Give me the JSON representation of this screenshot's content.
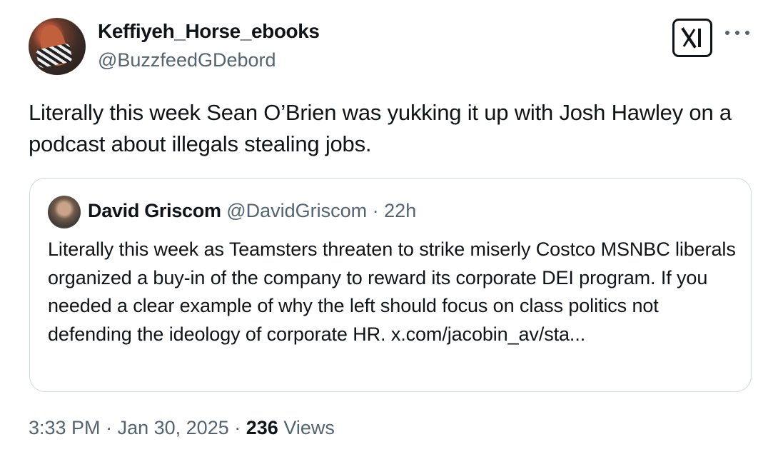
{
  "author": {
    "display_name": "Keffiyeh_Horse_ebooks",
    "handle": "@BuzzfeedGDebord"
  },
  "tweet": {
    "text": "Literally this week Sean O’Brien was yukking it up with Josh Hawley on a podcast about illegals stealing jobs."
  },
  "quoted_tweet": {
    "display_name": "David Griscom",
    "handle": "@DavidGriscom",
    "separator": "·",
    "age": "22h",
    "text": "Literally this week as Teamsters threaten to strike miserly Costco MSNBC liberals organized a buy-in of the company to reward its corporate DEI program. If you needed a clear example of why the left should focus on class politics not defending the ideology of corporate HR. x.com/jacobin_av/sta..."
  },
  "footer": {
    "time": "3:33 PM",
    "date": "Jan 30, 2025",
    "separator": "·",
    "views_count": "236",
    "views_label": "Views"
  },
  "icons": {
    "brand": "x-logo-icon",
    "more": "more-options-icon"
  }
}
